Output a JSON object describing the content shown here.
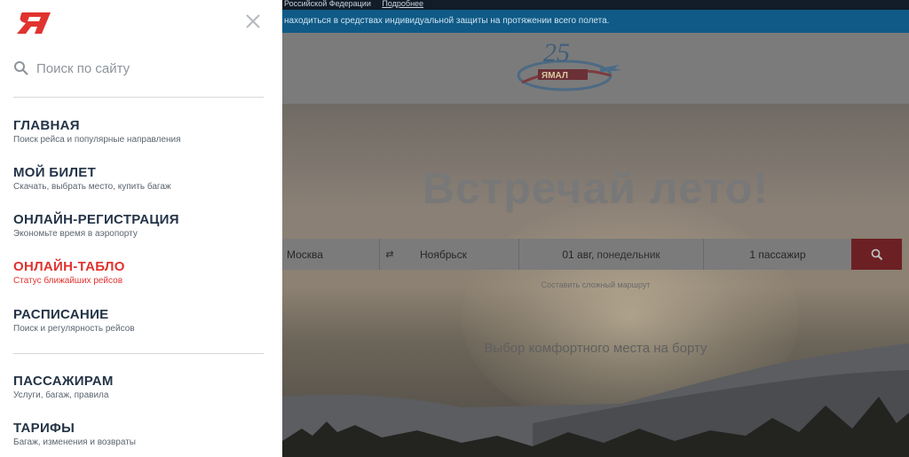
{
  "background": {
    "top_strip": {
      "text": "Российской Федерации",
      "link": "Подробнее"
    },
    "notice": "находиться в средствах индивидуальной защиты на протяжении всего полета.",
    "logo_icon": "yamal-25-anniversary-logo",
    "hero_title": "Встречай лето!",
    "search": {
      "from": "Москва",
      "swap_icon": "swap-arrows-icon",
      "to": "Ноябрьск",
      "date": "01 авг,",
      "weekday": "понедельник",
      "passengers": "1 пассажир",
      "button_icon": "search-icon"
    },
    "complex_route": "Составить сложный маршрут",
    "seat_text": "Выбор комфортного места на борту"
  },
  "menu": {
    "brand_icon": "yamal-logo-icon",
    "close_icon": "close-icon",
    "search_placeholder": "Поиск по сайту",
    "items": [
      {
        "title": "ГЛАВНАЯ",
        "subtitle": "Поиск рейса и популярные направления"
      },
      {
        "title": "МОЙ БИЛЕТ",
        "subtitle": "Скачать, выбрать место, купить багаж"
      },
      {
        "title": "ОНЛАЙН-РЕГИСТРАЦИЯ",
        "subtitle": "Экономьте время в аэропорту"
      },
      {
        "title": "ОНЛАЙН-ТАБЛО",
        "subtitle": "Статус ближайших рейсов",
        "active": true
      },
      {
        "title": "РАСПИСАНИЕ",
        "subtitle": "Поиск и регулярность рейсов"
      },
      {
        "title": "ПАССАЖИРАМ",
        "subtitle": "Услуги, багаж, правила"
      },
      {
        "title": "ТАРИФЫ",
        "subtitle": "Багаж, изменения и возвраты"
      }
    ]
  },
  "colors": {
    "accent_red": "#e0332f",
    "menu_title": "#243447",
    "overlay_dim": "#6e6860"
  }
}
